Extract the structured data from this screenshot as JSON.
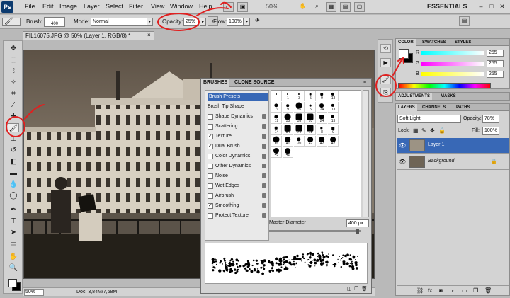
{
  "app": {
    "logo": "Ps"
  },
  "menu": [
    "File",
    "Edit",
    "Image",
    "Layer",
    "Select",
    "Filter",
    "View",
    "Window",
    "Help"
  ],
  "menubar": {
    "zoom": "50%",
    "workspace": "ESSENTIALS"
  },
  "options": {
    "brush_label": "Brush:",
    "brush_size": "400",
    "mode_label": "Mode:",
    "mode_value": "Normal",
    "opacity_label": "Opacity:",
    "opacity_value": "25%",
    "flow_label": "Flow:",
    "flow_value": "100%"
  },
  "document": {
    "tab_title": "FIL16075.JPG @ 50% (Layer 1, RGB/8) *",
    "status_zoom": "50%",
    "status_doc": "Doc: 3,84M/7,68M"
  },
  "brushes_panel": {
    "tabs": [
      "BRUSHES",
      "CLONE SOURCE"
    ],
    "options": [
      {
        "label": "Brush Presets",
        "checkbox": false,
        "checked": false,
        "lock": false,
        "selected": true
      },
      {
        "label": "Brush Tip Shape",
        "checkbox": false,
        "checked": false,
        "lock": false,
        "selected": false
      },
      {
        "label": "Shape Dynamics",
        "checkbox": true,
        "checked": false,
        "lock": true,
        "selected": false
      },
      {
        "label": "Scattering",
        "checkbox": true,
        "checked": false,
        "lock": true,
        "selected": false
      },
      {
        "label": "Texture",
        "checkbox": true,
        "checked": true,
        "lock": true,
        "selected": false
      },
      {
        "label": "Dual Brush",
        "checkbox": true,
        "checked": true,
        "lock": true,
        "selected": false
      },
      {
        "label": "Color Dynamics",
        "checkbox": true,
        "checked": false,
        "lock": true,
        "selected": false
      },
      {
        "label": "Other Dynamics",
        "checkbox": true,
        "checked": false,
        "lock": true,
        "selected": false
      },
      {
        "label": "Noise",
        "checkbox": true,
        "checked": false,
        "lock": true,
        "selected": false
      },
      {
        "label": "Wet Edges",
        "checkbox": true,
        "checked": false,
        "lock": true,
        "selected": false
      },
      {
        "label": "Airbrush",
        "checkbox": true,
        "checked": false,
        "lock": true,
        "selected": false
      },
      {
        "label": "Smoothing",
        "checkbox": true,
        "checked": true,
        "lock": true,
        "selected": false
      },
      {
        "label": "Protect Texture",
        "checkbox": true,
        "checked": false,
        "lock": true,
        "selected": false
      }
    ],
    "brush_sizes": [
      "",
      "1",
      "3",
      "5",
      "9",
      "13",
      "19",
      "9",
      "55",
      "5",
      "24",
      "13",
      "19",
      "55",
      "55",
      "95",
      "24",
      "13",
      "14",
      "54",
      "74",
      "78",
      "8",
      "9",
      "61",
      "41",
      "20",
      "42",
      "42",
      "42",
      "45",
      "42"
    ],
    "master_diameter_label": "Master Diameter",
    "master_diameter_value": "400 px"
  },
  "color_panel": {
    "tabs": [
      "COLOR",
      "SWATCHES",
      "STYLES"
    ],
    "channels": [
      {
        "name": "R",
        "value": "255"
      },
      {
        "name": "G",
        "value": "255"
      },
      {
        "name": "B",
        "value": "255"
      }
    ]
  },
  "adjustments_panel": {
    "tabs": [
      "ADJUSTMENTS",
      "MASKS"
    ]
  },
  "layers_panel": {
    "tabs": [
      "LAYERS",
      "CHANNELS",
      "PATHS"
    ],
    "blend_mode": "Soft Light",
    "opacity_label": "Opacity:",
    "opacity_value": "78%",
    "lock_label": "Lock:",
    "fill_label": "Fill:",
    "fill_value": "100%",
    "layers": [
      {
        "name": "Layer 1",
        "selected": true,
        "italic": false
      },
      {
        "name": "Background",
        "selected": false,
        "italic": true
      }
    ]
  },
  "annotation_color": "#e02020"
}
